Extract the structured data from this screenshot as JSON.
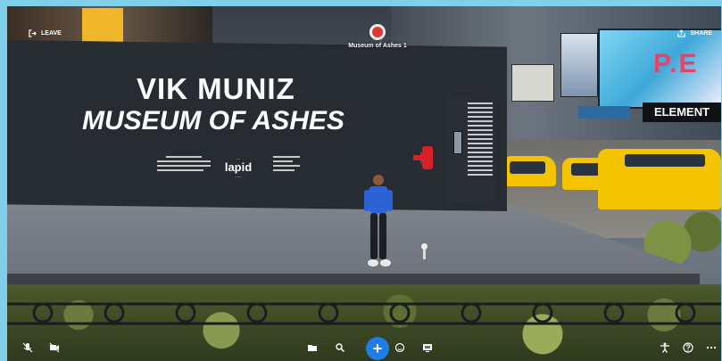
{
  "header": {
    "leave_label": "LEAVE",
    "share_label": "SHARE",
    "room_name": "Museum of Ashes 1"
  },
  "scene": {
    "title_line_1": "VIK MUNIZ",
    "title_line_2": "MUSEUM OF ASHES",
    "sponsor_logo": "lapid",
    "store_sign": "ELEMENT",
    "billboard_text": "P.E"
  },
  "toolbar": {
    "add_symbol": "+",
    "icons": [
      "microphone-off-icon",
      "camera-off-icon",
      "folder-icon",
      "search-icon",
      "add-icon",
      "emoji-icon",
      "screen-share-icon",
      "avatar-icon",
      "help-icon",
      "more-icon"
    ]
  },
  "colors": {
    "accent": "#1f7de6",
    "room_badge": "#e0362f",
    "frame": "#7fd0e8"
  }
}
